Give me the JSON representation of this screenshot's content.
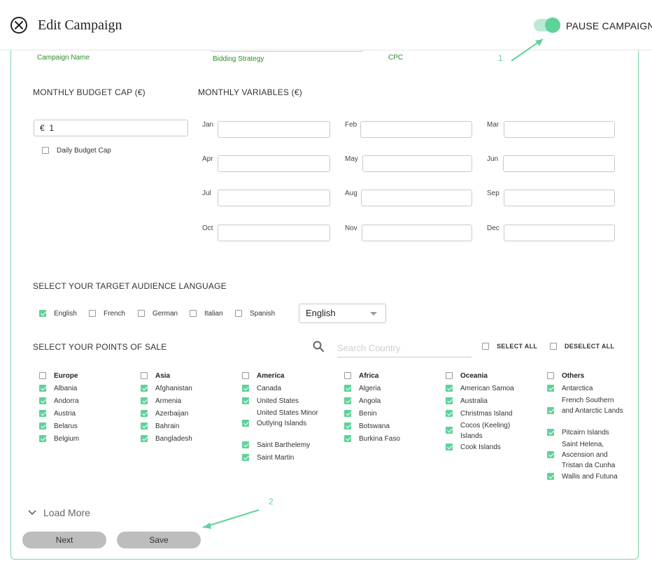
{
  "header": {
    "title": "Edit Campaign",
    "pause_label": "PAUSE CAMPAIGN",
    "pause_toggle_on": true
  },
  "top_fields": {
    "campaign_name": "Campaign Name",
    "bidding_strategy": "Bidding Strategy",
    "cpc": "CPC"
  },
  "budget": {
    "title": "MONTHLY BUDGET CAP (€)",
    "currency": "€",
    "value": "1",
    "daily_cap_label": "Daily Budget Cap"
  },
  "variables": {
    "title": "MONTHLY VARIABLES (€)",
    "months": [
      "Jan",
      "Feb",
      "Mar",
      "Apr",
      "May",
      "Jun",
      "Jul",
      "Aug",
      "Sep",
      "Oct",
      "Nov",
      "Dec"
    ]
  },
  "language": {
    "title": "SELECT YOUR TARGET AUDIENCE LANGUAGE",
    "options": [
      {
        "label": "English",
        "checked": true
      },
      {
        "label": "French",
        "checked": false
      },
      {
        "label": "German",
        "checked": false
      },
      {
        "label": "Italian",
        "checked": false
      },
      {
        "label": "Spanish",
        "checked": false
      }
    ],
    "selected": "English"
  },
  "points_of_sale": {
    "title": "SELECT YOUR POINTS OF SALE",
    "search_placeholder": "Search Country",
    "select_all": "SELECT ALL",
    "deselect_all": "DESELECT ALL",
    "regions": [
      {
        "name": "Europe",
        "countries": [
          "Albania",
          "Andorra",
          "Austria",
          "Belarus",
          "Belgium"
        ]
      },
      {
        "name": "Asia",
        "countries": [
          "Afghanistan",
          "Armenia",
          "Azerbaijan",
          "Bahrain",
          "Bangladesh"
        ]
      },
      {
        "name": "America",
        "countries": [
          "Canada",
          "United States",
          "United States Minor Outlying Islands",
          "Saint Barthelemy",
          "Saint Martin"
        ]
      },
      {
        "name": "Africa",
        "countries": [
          "Algeria",
          "Angola",
          "Benin",
          "Botswana",
          "Burkina Faso"
        ]
      },
      {
        "name": "Oceania",
        "countries": [
          "American Samoa",
          "Australia",
          "Christmas Island",
          "Cocos (Keeling) Islands",
          "Cook Islands"
        ]
      },
      {
        "name": "Others",
        "countries": [
          "Antarctica",
          "French Southern and Antarctic Lands",
          "Pitcairn Islands",
          "Saint Helena, Ascension and Tristan da Cunha",
          "Wallis and Futuna"
        ]
      }
    ]
  },
  "footer": {
    "load_more": "Load More",
    "next": "Next",
    "save": "Save"
  },
  "annotations": {
    "one": "1",
    "two": "2"
  },
  "colors": {
    "accent": "#5fd29a",
    "label_green": "#2e8b2e",
    "button_gray": "#bdbdbd"
  }
}
